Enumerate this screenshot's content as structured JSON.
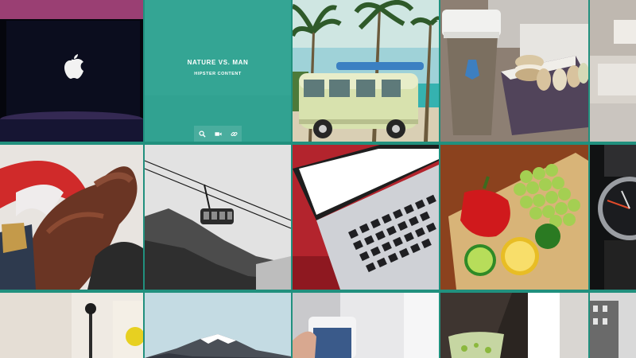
{
  "gallery": {
    "featured": {
      "title": "NATURE VS. MAN",
      "subtitle": "HIPSTER CONTENT",
      "actions": [
        {
          "icon": "search-icon"
        },
        {
          "icon": "video-camera-icon"
        },
        {
          "icon": "link-icon"
        }
      ]
    },
    "tiles": [
      {
        "icon": "apple-laptop-image"
      },
      {
        "icon": "surf-van-image"
      },
      {
        "icon": "coffee-macarons-image"
      },
      {
        "icon": "leather-glove-steering-image"
      },
      {
        "icon": "cable-car-image"
      },
      {
        "icon": "laptop-keyboard-image"
      },
      {
        "icon": "pepper-grapes-lemons-image"
      },
      {
        "icon": "wristwatch-image"
      },
      {
        "icon": "desk-microphone-image"
      },
      {
        "icon": "snowy-mountain-image"
      },
      {
        "icon": "iphone-hand-image"
      },
      {
        "icon": "drink-glass-image"
      },
      {
        "icon": "building-image"
      }
    ],
    "colors": {
      "accent": "#2aa290",
      "divider": "#21907e"
    }
  }
}
